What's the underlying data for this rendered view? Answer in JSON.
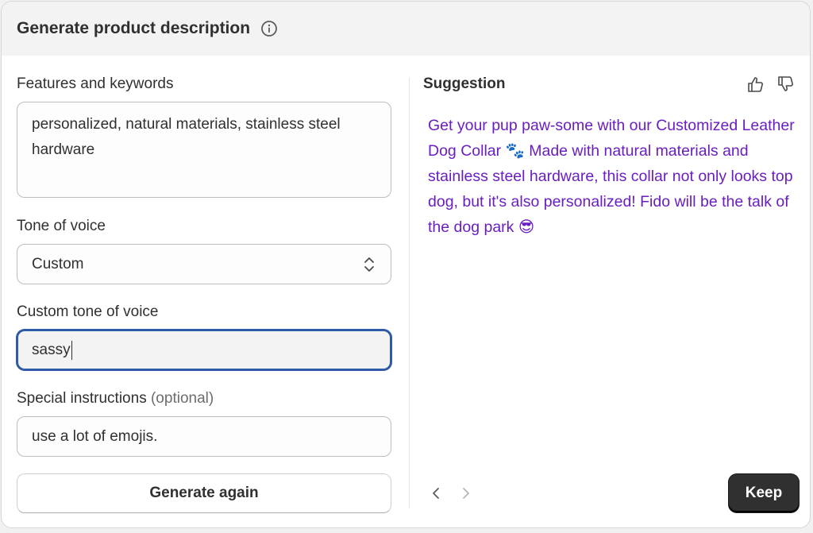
{
  "header": {
    "title": "Generate product description",
    "info_icon": "info-circle"
  },
  "form": {
    "features_label": "Features and keywords",
    "features_value": "personalized, natural materials, stainless steel hardware",
    "tone_label": "Tone of voice",
    "tone_selected": "Custom",
    "custom_tone_label": "Custom tone of voice",
    "custom_tone_value": "sassy",
    "special_label": "Special instructions",
    "special_optional": "(optional)",
    "special_value": "use a lot of emojis.",
    "generate_again_label": "Generate again"
  },
  "suggestion": {
    "label": "Suggestion",
    "text": "Get your pup paw-some with our Customized Leather Dog Collar 🐾 Made with natural materials and stainless steel hardware, this collar not only looks top dog, but it's also personalized! Fido will be the talk of the dog park 😎",
    "keep_label": "Keep",
    "text_color": "#6a1ec0"
  },
  "colors": {
    "primary_button": "#303030",
    "focus_ring": "#2f5aa8"
  }
}
